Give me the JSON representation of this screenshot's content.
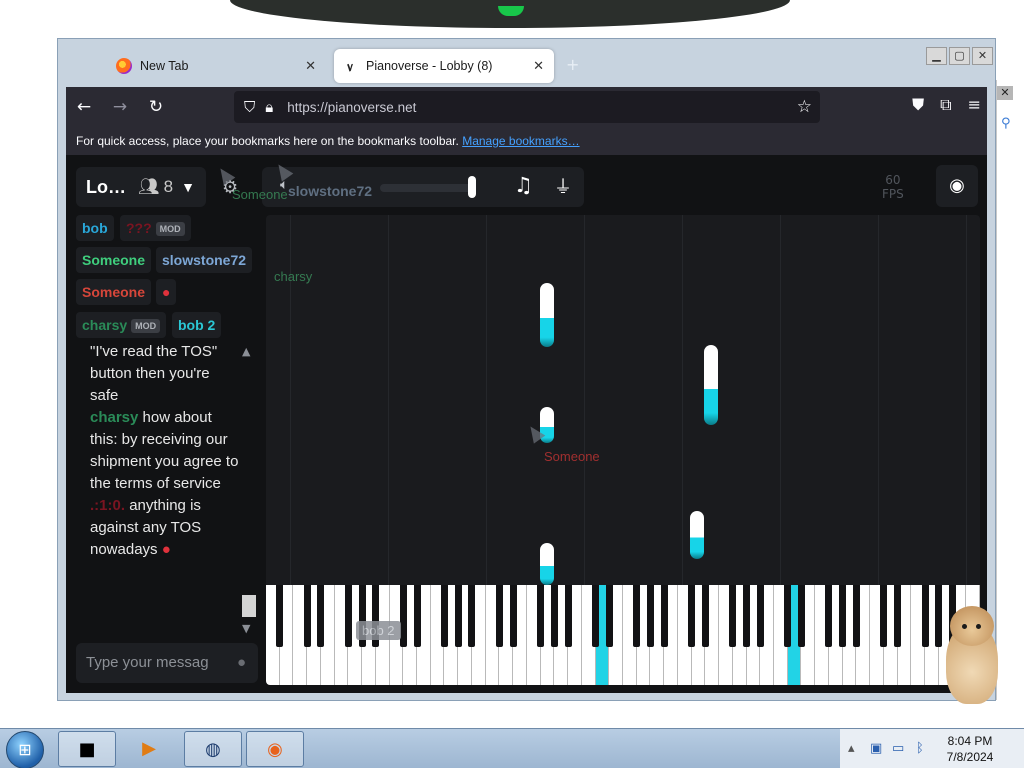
{
  "browser": {
    "tabs": [
      {
        "title": "New Tab",
        "active": false
      },
      {
        "title": "Pianoverse - Lobby (8)",
        "active": true
      }
    ],
    "url": "https://pianoverse.net",
    "bookmarks_text": "For quick access, place your bookmarks here on the bookmarks toolbar.",
    "bookmarks_link": "Manage bookmarks…"
  },
  "app": {
    "room_name": "Lo…",
    "people_count": "8",
    "fps_value": "60",
    "fps_label": "FPS",
    "ghost_labels": {
      "someone_top": "Someone",
      "slowstone_top": "slowstone72",
      "charsy_roll": "charsy",
      "someone_roll": "Someone",
      "bob2_roll": "bob 2"
    },
    "users": [
      {
        "name": "bob",
        "color": "#29a7d9",
        "mod": false
      },
      {
        "name": "???",
        "color": "#7a1421",
        "mod": true,
        "mod_label": "MOD"
      },
      {
        "name": "Someone",
        "color": "#3fce7d",
        "mod": false
      },
      {
        "name": "slowstone72",
        "color": "#7da7d6",
        "mod": false
      },
      {
        "name": "Someone",
        "color": "#d6463a",
        "mod": false
      },
      {
        "name": "charsy",
        "color": "#2a8b58",
        "mod": true,
        "mod_label": "MOD"
      },
      {
        "name": "bob 2",
        "color": "#2bc7d4",
        "mod": false
      }
    ],
    "chat": {
      "line1": "\"I've read the TOS\" button then you're safe",
      "msg2_user": "charsy",
      "msg2_text": "how about this: by receiving our shipment you agree to the terms of service",
      "msg3_user": ".:1:0.",
      "msg3_text": "anything is against any TOS nowadays"
    },
    "input_placeholder": "Type your messag"
  },
  "taskbar": {
    "time": "8:04 PM",
    "date": "7/8/2024"
  },
  "colors": {
    "accent": "#17d4e8",
    "background": "#111214"
  }
}
